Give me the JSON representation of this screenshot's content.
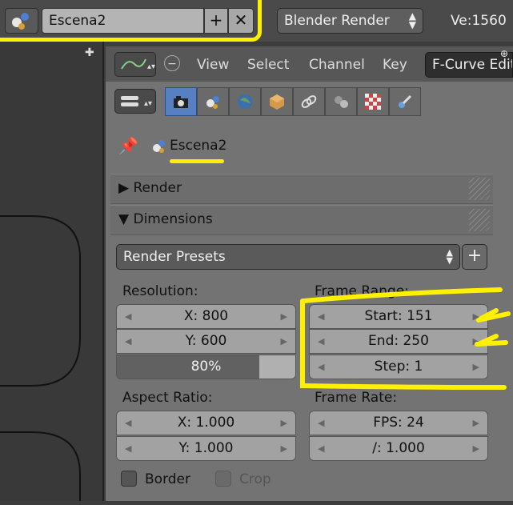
{
  "topbar": {
    "scene_name": "Escena2",
    "add_label": "+",
    "remove_label": "✕",
    "render_engine": "Blender Render",
    "version": "Ve:1560"
  },
  "header": {
    "menus": [
      "View",
      "Select",
      "Channel",
      "Key"
    ],
    "editor_mode": "F-Curve Editor"
  },
  "tabs": [
    {
      "icon": "render-icon",
      "active": true
    },
    {
      "icon": "scene-icon",
      "active": false
    },
    {
      "icon": "world-icon",
      "active": false
    },
    {
      "icon": "object-icon",
      "active": false
    },
    {
      "icon": "constraint-icon",
      "active": false
    },
    {
      "icon": "modifier-icon",
      "active": false
    },
    {
      "icon": "texture-icon",
      "active": false
    },
    {
      "icon": "physics-icon",
      "active": false
    }
  ],
  "breadcrumb": {
    "scene": "Escena2"
  },
  "panels": {
    "render": "Render",
    "dimensions": "Dimensions"
  },
  "dimensions": {
    "presets": "Render Presets",
    "resolution_label": "Resolution:",
    "res_x": "X: 800",
    "res_y": "Y: 600",
    "res_pct": "80%",
    "res_pct_value": 0.8,
    "frame_range_label": "Frame Range:",
    "start": "Start: 151",
    "end": "End: 250",
    "step": "Step: 1",
    "aspect_label": "Aspect Ratio:",
    "aspect_x": "X: 1.000",
    "aspect_y": "Y: 1.000",
    "frame_rate_label": "Frame Rate:",
    "fps": "FPS: 24",
    "fps_base": "/: 1.000",
    "border_label": "Border",
    "crop_label": "Crop"
  },
  "colors": {
    "highlight": "#fff000",
    "active_tab": "#5680c2"
  }
}
